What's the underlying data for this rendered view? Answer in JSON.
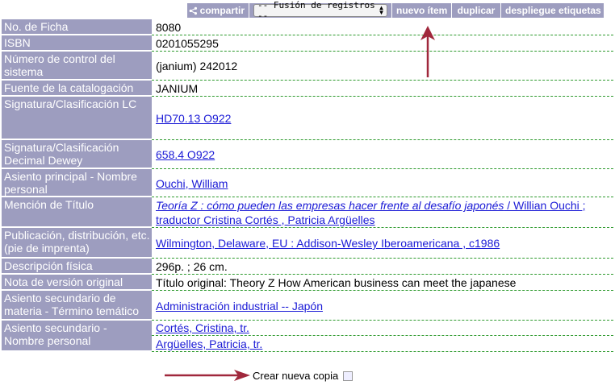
{
  "toolbar": {
    "share_label": "compartir",
    "select_value": "-- Fusión de registros --",
    "new_item_label": "nuevo ítem",
    "duplicate_label": "duplicar",
    "show_labels_label": "despliegue etiquetas"
  },
  "record": [
    {
      "label": "No. de Ficha",
      "value": "8080"
    },
    {
      "label": "ISBN",
      "value": "0201055295"
    },
    {
      "label": "Número de control del sistema",
      "value": "(janium) 242012"
    },
    {
      "label": "Fuente de la catalogación",
      "value": "JANIUM"
    },
    {
      "label": "Signatura/Clasificación LC",
      "value": "HD70.13 O922"
    },
    {
      "label": "Signatura/Clasificación Decimal Dewey",
      "value": "658.4 O922"
    },
    {
      "label": "Asiento principal - Nombre personal",
      "value": "Ouchi, William"
    },
    {
      "label": "Mención de Título",
      "value_title": "Teoría Z : cómo pueden las empresas hacer frente al desafío japonés",
      "value_rest": " / Willian Ouchi ; traductor Cristina Cortés , Patricia Argüelles"
    },
    {
      "label": "Publicación, distribución, etc. (pie de imprenta)",
      "value": "Wilmington, Delaware, EU : Addison-Wesley Iberoamericana , c1986"
    },
    {
      "label": "Descripción física",
      "value": "296p. ; 26 cm."
    },
    {
      "label": "Nota de versión original",
      "value": "Título original: Theory Z How American business can meet the japanese"
    },
    {
      "label": "Asiento secundario de materia - Término temático",
      "value": "Administración industrial -- Japón"
    },
    {
      "label": "Asiento secundario - Nombre personal",
      "values": [
        "Cortés, Cristina, tr.",
        "Argüelles, Patricia, tr."
      ]
    }
  ],
  "footer": {
    "create_copy_label": "Crear nueva copia"
  },
  "colors": {
    "label_bg": "#9d9dbf",
    "link": "#1a1ad6",
    "annotation_arrow": "#a0283c",
    "row_divider": "#2d9a2d"
  }
}
